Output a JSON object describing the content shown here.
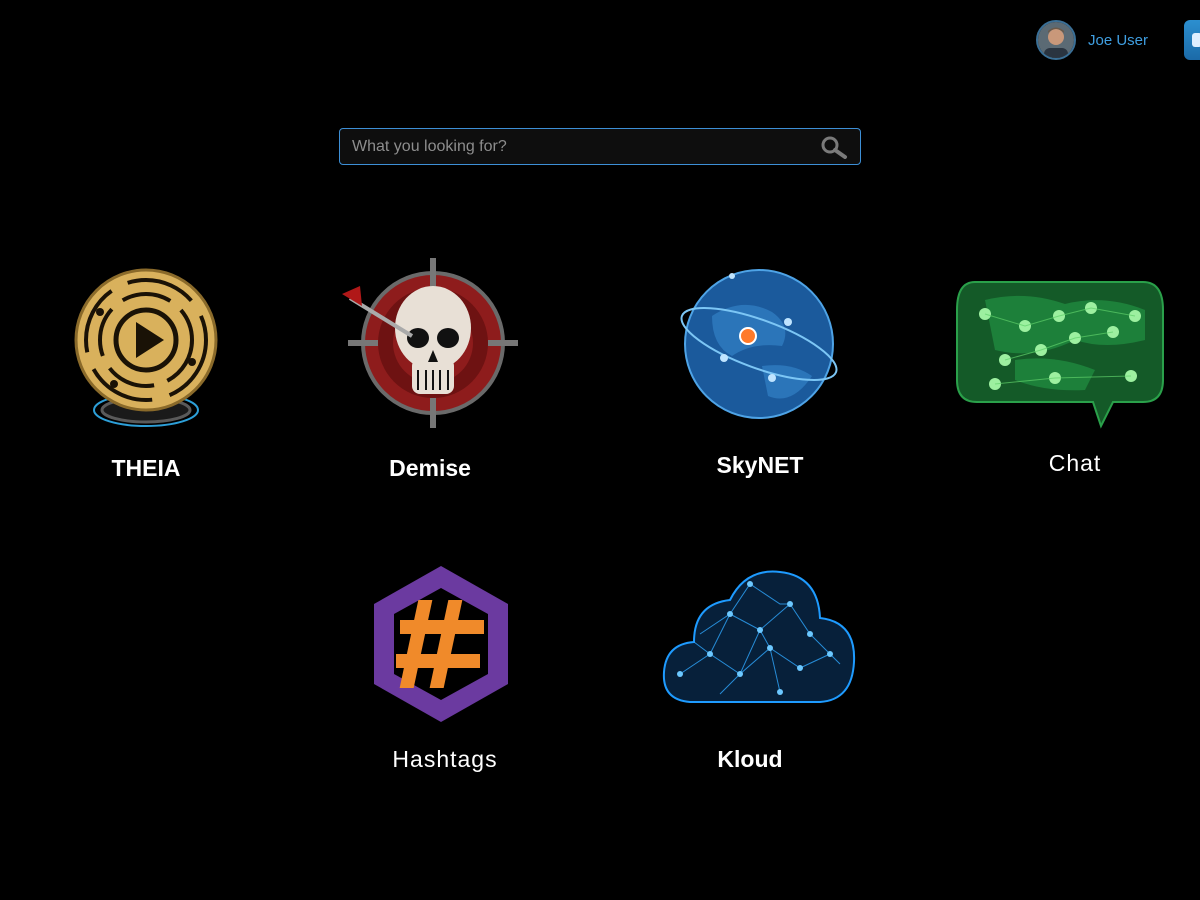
{
  "user": {
    "name": "Joe User"
  },
  "search": {
    "placeholder": "What you looking for?"
  },
  "apps": [
    {
      "label": "THEIA"
    },
    {
      "label": "Demise"
    },
    {
      "label": "SkyNET"
    },
    {
      "label": "Chat"
    },
    {
      "label": "Hashtags"
    },
    {
      "label": "Kloud"
    }
  ],
  "colors": {
    "accent": "#3d8fd6",
    "background": "#000000",
    "theia_gold": "#d9b15c",
    "demise_red": "#8e1c1c",
    "skynet_blue": "#1b5a9c",
    "chat_green": "#1f8a3e",
    "hashtags_purple": "#6b3aa0",
    "hashtags_orange": "#f08a2a",
    "kloud_blue": "#1e9bff"
  }
}
